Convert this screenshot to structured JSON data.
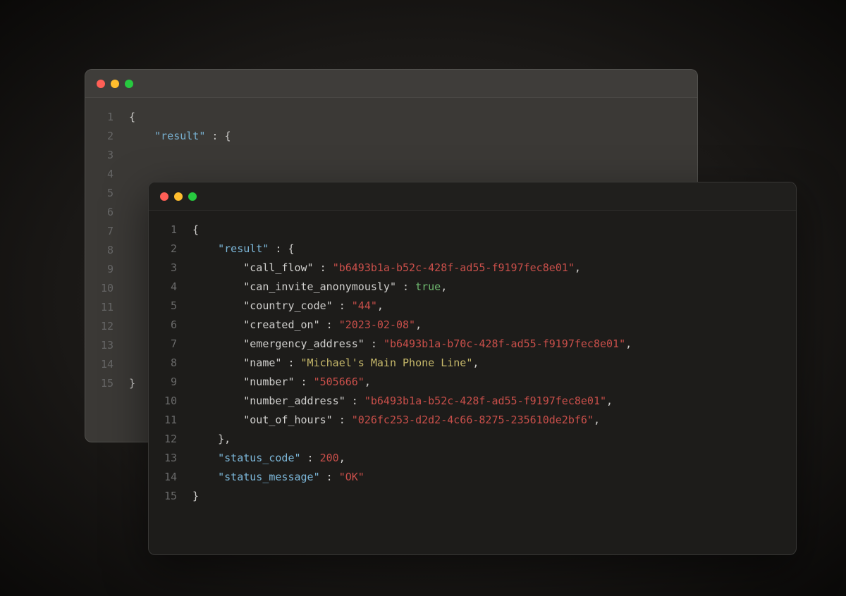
{
  "back_window": {
    "line_count": 15,
    "lines": [
      {
        "tokens": [
          {
            "t": "{",
            "c": "punct"
          }
        ]
      },
      {
        "tokens": [
          {
            "t": "    ",
            "c": "punct"
          },
          {
            "t": "\"result\"",
            "c": "key"
          },
          {
            "t": " : {",
            "c": "punct"
          }
        ]
      },
      {
        "tokens": [
          {
            "t": "        ",
            "c": "punct"
          }
        ]
      },
      {
        "tokens": []
      },
      {
        "tokens": []
      },
      {
        "tokens": []
      },
      {
        "tokens": []
      },
      {
        "tokens": []
      },
      {
        "tokens": []
      },
      {
        "tokens": []
      },
      {
        "tokens": []
      },
      {
        "tokens": []
      },
      {
        "tokens": []
      },
      {
        "tokens": []
      },
      {
        "tokens": [
          {
            "t": "}",
            "c": "punct"
          }
        ]
      }
    ]
  },
  "front_window": {
    "line_count": 15,
    "lines": [
      {
        "tokens": [
          {
            "t": "{",
            "c": "punct"
          }
        ]
      },
      {
        "tokens": [
          {
            "t": "    ",
            "c": "punct"
          },
          {
            "t": "\"result\"",
            "c": "key"
          },
          {
            "t": " : {",
            "c": "punct"
          }
        ]
      },
      {
        "tokens": [
          {
            "t": "        ",
            "c": "punct"
          },
          {
            "t": "\"call_flow\"",
            "c": "punct"
          },
          {
            "t": " : ",
            "c": "punct"
          },
          {
            "t": "\"b6493b1a-b52c-428f-ad55-f9197fec8e01\"",
            "c": "string-red"
          },
          {
            "t": ",",
            "c": "punct"
          }
        ]
      },
      {
        "tokens": [
          {
            "t": "        ",
            "c": "punct"
          },
          {
            "t": "\"can_invite_anonymously\"",
            "c": "punct"
          },
          {
            "t": " : ",
            "c": "punct"
          },
          {
            "t": "true",
            "c": "bool"
          },
          {
            "t": ",",
            "c": "punct"
          }
        ]
      },
      {
        "tokens": [
          {
            "t": "        ",
            "c": "punct"
          },
          {
            "t": "\"country_code\"",
            "c": "punct"
          },
          {
            "t": " : ",
            "c": "punct"
          },
          {
            "t": "\"44\"",
            "c": "string-red"
          },
          {
            "t": ",",
            "c": "punct"
          }
        ]
      },
      {
        "tokens": [
          {
            "t": "        ",
            "c": "punct"
          },
          {
            "t": "\"created_on\"",
            "c": "punct"
          },
          {
            "t": " : ",
            "c": "punct"
          },
          {
            "t": "\"2023-02-08\"",
            "c": "string-red"
          },
          {
            "t": ",",
            "c": "punct"
          }
        ]
      },
      {
        "tokens": [
          {
            "t": "        ",
            "c": "punct"
          },
          {
            "t": "\"emergency_address\"",
            "c": "punct"
          },
          {
            "t": " : ",
            "c": "punct"
          },
          {
            "t": "\"b6493b1a-b70c-428f-ad55-f9197fec8e01\"",
            "c": "string-red"
          },
          {
            "t": ",",
            "c": "punct"
          }
        ]
      },
      {
        "tokens": [
          {
            "t": "        ",
            "c": "punct"
          },
          {
            "t": "\"name\"",
            "c": "punct"
          },
          {
            "t": " : ",
            "c": "punct"
          },
          {
            "t": "\"Michael's Main Phone Line\"",
            "c": "string-yellow"
          },
          {
            "t": ",",
            "c": "punct"
          }
        ]
      },
      {
        "tokens": [
          {
            "t": "        ",
            "c": "punct"
          },
          {
            "t": "\"number\"",
            "c": "punct"
          },
          {
            "t": " : ",
            "c": "punct"
          },
          {
            "t": "\"505666\"",
            "c": "string-red"
          },
          {
            "t": ",",
            "c": "punct"
          }
        ]
      },
      {
        "tokens": [
          {
            "t": "        ",
            "c": "punct"
          },
          {
            "t": "\"number_address\"",
            "c": "punct"
          },
          {
            "t": " : ",
            "c": "punct"
          },
          {
            "t": "\"b6493b1a-b52c-428f-ad55-f9197fec8e01\"",
            "c": "string-red"
          },
          {
            "t": ",",
            "c": "punct"
          }
        ]
      },
      {
        "tokens": [
          {
            "t": "        ",
            "c": "punct"
          },
          {
            "t": "\"out_of_hours\"",
            "c": "punct"
          },
          {
            "t": " : ",
            "c": "punct"
          },
          {
            "t": "\"026fc253-d2d2-4c66-8275-235610de2bf6\"",
            "c": "string-red"
          },
          {
            "t": ",",
            "c": "punct"
          }
        ]
      },
      {
        "tokens": [
          {
            "t": "    ",
            "c": "punct"
          },
          {
            "t": "},",
            "c": "punct"
          }
        ]
      },
      {
        "tokens": [
          {
            "t": "    ",
            "c": "punct"
          },
          {
            "t": "\"status_code\"",
            "c": "key"
          },
          {
            "t": " : ",
            "c": "punct"
          },
          {
            "t": "200",
            "c": "number"
          },
          {
            "t": ",",
            "c": "punct"
          }
        ]
      },
      {
        "tokens": [
          {
            "t": "    ",
            "c": "punct"
          },
          {
            "t": "\"status_message\"",
            "c": "key"
          },
          {
            "t": " : ",
            "c": "punct"
          },
          {
            "t": "\"OK\"",
            "c": "string-red"
          }
        ]
      },
      {
        "tokens": [
          {
            "t": "}",
            "c": "punct"
          }
        ]
      }
    ]
  }
}
